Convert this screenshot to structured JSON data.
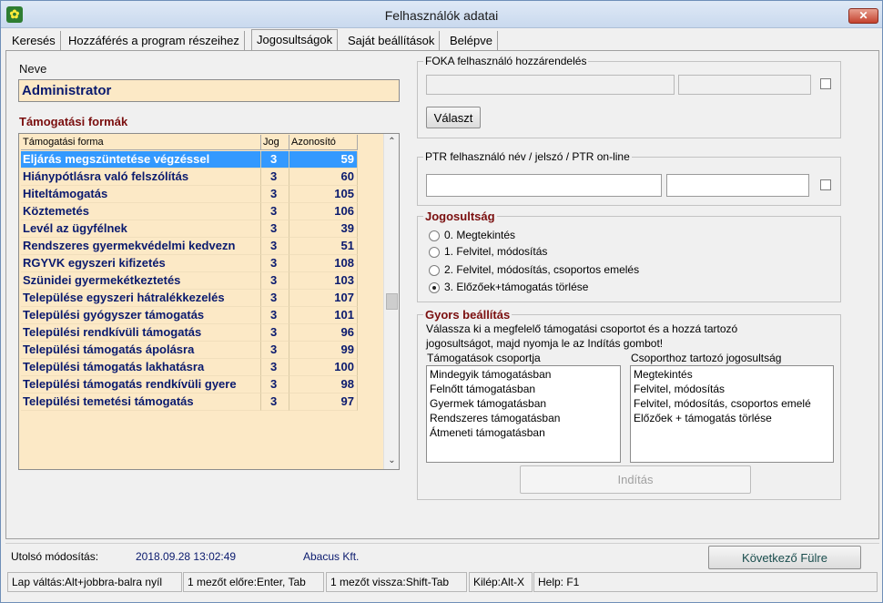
{
  "window": {
    "title": "Felhasználók adatai",
    "close_glyph": "✕"
  },
  "tabs": [
    {
      "label": "Keresés"
    },
    {
      "label": "Hozzáférés a program részeihez"
    },
    {
      "label": "Jogosultságok"
    },
    {
      "label": "Saját beállítások"
    },
    {
      "label": "Belépve"
    }
  ],
  "neve": {
    "label": "Neve",
    "value": "Administrator"
  },
  "tamogatasi_formak": {
    "title": "Támogatási formák",
    "columns": [
      "Támogatási forma",
      "Jog",
      "Azonosító"
    ],
    "rows": [
      {
        "forma": "Eljárás megszüntetése végzéssel",
        "jog": "3",
        "azon": "59"
      },
      {
        "forma": "Hiánypótlásra való felszólítás",
        "jog": "3",
        "azon": "60"
      },
      {
        "forma": "Hiteltámogatás",
        "jog": "3",
        "azon": "105"
      },
      {
        "forma": "Köztemetés",
        "jog": "3",
        "azon": "106"
      },
      {
        "forma": "Levél az ügyfélnek",
        "jog": "3",
        "azon": "39"
      },
      {
        "forma": "Rendszeres gyermekvédelmi kedvezn",
        "jog": "3",
        "azon": "51"
      },
      {
        "forma": "RGYVK egyszeri kifizetés",
        "jog": "3",
        "azon": "108"
      },
      {
        "forma": "Szünidei gyermekétkeztetés",
        "jog": "3",
        "azon": "103"
      },
      {
        "forma": "Települése egyszeri hátralékkezelés",
        "jog": "3",
        "azon": "107"
      },
      {
        "forma": "Települési gyógyszer támogatás",
        "jog": "3",
        "azon": "101"
      },
      {
        "forma": "Települési rendkívüli támogatás",
        "jog": "3",
        "azon": "96"
      },
      {
        "forma": "Települési támogatás ápolásra",
        "jog": "3",
        "azon": "99"
      },
      {
        "forma": "Települési támogatás lakhatásra",
        "jog": "3",
        "azon": "100"
      },
      {
        "forma": "Települési támogatás rendkívüli gyere",
        "jog": "3",
        "azon": "98"
      },
      {
        "forma": "Települési temetési támogatás",
        "jog": "3",
        "azon": "97"
      }
    ],
    "selected_index": 0,
    "scroll_up_glyph": "⌃",
    "scroll_down_glyph": "⌄"
  },
  "foka": {
    "title": "FOKA felhasználó hozzárendelés",
    "button": "Választ"
  },
  "ptr": {
    "title": "PTR felhasználó név / jelszó / PTR on-line"
  },
  "jogosultsag": {
    "title": "Jogosultság",
    "options": [
      "0. Megtekintés",
      "1. Felvitel, módosítás",
      "2. Felvitel, módosítás, csoportos emelés",
      "3. Előzőek+támogatás törlése"
    ],
    "selected_index": 3
  },
  "gyors": {
    "title": "Gyors beállítás",
    "instruction_1": "Válassza ki a megfelelő támogatási csoportot és a  hozzá tartozó",
    "instruction_2": "jogosultságot, majd nyomja le az Indítás gombot!",
    "list1_label": "Támogatások csoportja",
    "list1": [
      "Mindegyik támogatásban",
      "Felnőtt támogatásban",
      "Gyermek támogatásban",
      "Rendszeres támogatásban",
      "Átmeneti támogatásban"
    ],
    "list2_label": "Csoporthoz tartozó jogosultság",
    "list2": [
      "Megtekintés",
      "Felvitel, módosítás",
      "Felvitel, módosítás, csoportos emelé",
      "Előzőek + támogatás törlése"
    ],
    "start_button": "Indítás"
  },
  "last_modified": {
    "label": "Utolsó módosítás:",
    "datetime": "2018.09.28 13:02:49",
    "company": "Abacus Kft."
  },
  "next_tab_button": "Következő Fülre",
  "statusbar": [
    "Lap váltás:Alt+jobbra-balra nyíl",
    "1 mezőt előre:Enter, Tab",
    "1 mezőt vissza:Shift-Tab",
    "Kilép:Alt-X",
    "Help: F1"
  ],
  "colors": {
    "selection": "#3399ff",
    "grid_bg": "#fce9c6",
    "section_title": "#7a0e0e",
    "grid_text": "#0a1a6e"
  }
}
